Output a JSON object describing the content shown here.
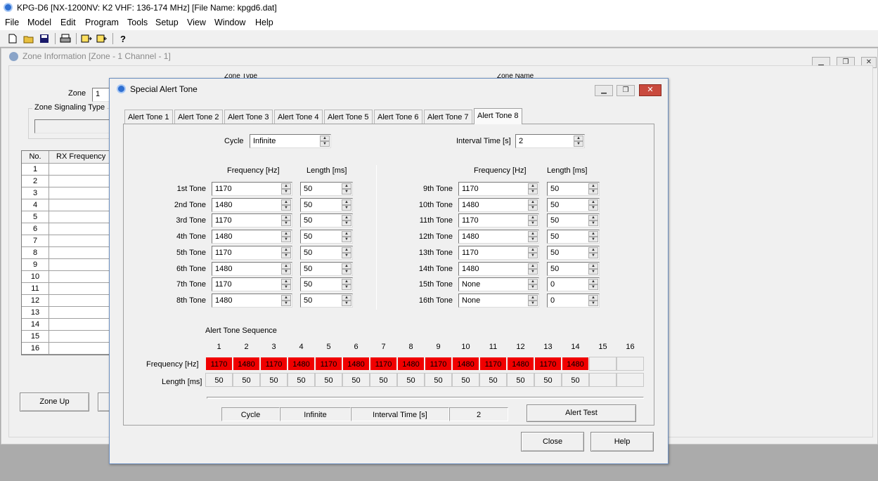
{
  "app": {
    "title": "KPG-D6 [NX-1200NV: K2 VHF: 136-174 MHz] [File Name: kpgd6.dat]"
  },
  "menu": [
    "File",
    "Model",
    "Edit",
    "Program",
    "Tools",
    "Setup",
    "View",
    "Window",
    "Help"
  ],
  "toolbar": {
    "icons": [
      "new-file-icon",
      "open-folder-icon",
      "save-icon",
      "print-icon",
      "read-radio-icon",
      "write-radio-icon",
      "help-icon"
    ]
  },
  "zone_window": {
    "title": "Zone Information [Zone - 1   Channel  -  1]",
    "zone_type_label": "Zone Type",
    "zone_name_label": "Zone Name",
    "zone_label": "Zone",
    "zone_value": "1",
    "signaling_label": "Zone Signaling Type",
    "grid_headers": [
      "No.",
      "RX Frequency"
    ],
    "rows": [
      "1",
      "2",
      "3",
      "4",
      "5",
      "6",
      "7",
      "8",
      "9",
      "10",
      "11",
      "12",
      "13",
      "14",
      "15",
      "16"
    ],
    "zone_up_label": "Zone Up"
  },
  "dialog": {
    "title": "Special Alert Tone",
    "tabs": [
      "Alert Tone 1",
      "Alert Tone 2",
      "Alert Tone 3",
      "Alert Tone 4",
      "Alert Tone 5",
      "Alert Tone 6",
      "Alert Tone 7",
      "Alert Tone 8"
    ],
    "active_tab": "Alert Tone 8",
    "cycle_label": "Cycle",
    "cycle_value": "Infinite",
    "interval_label": "Interval Time [s]",
    "interval_value": "2",
    "freq_header": "Frequency [Hz]",
    "length_header": "Length [ms]",
    "tones_left": [
      {
        "label": "1st Tone",
        "freq": "1170",
        "length": "50"
      },
      {
        "label": "2nd Tone",
        "freq": "1480",
        "length": "50"
      },
      {
        "label": "3rd Tone",
        "freq": "1170",
        "length": "50"
      },
      {
        "label": "4th Tone",
        "freq": "1480",
        "length": "50"
      },
      {
        "label": "5th Tone",
        "freq": "1170",
        "length": "50"
      },
      {
        "label": "6th Tone",
        "freq": "1480",
        "length": "50"
      },
      {
        "label": "7th Tone",
        "freq": "1170",
        "length": "50"
      },
      {
        "label": "8th Tone",
        "freq": "1480",
        "length": "50"
      }
    ],
    "tones_right": [
      {
        "label": "9th Tone",
        "freq": "1170",
        "length": "50"
      },
      {
        "label": "10th Tone",
        "freq": "1480",
        "length": "50"
      },
      {
        "label": "11th Tone",
        "freq": "1170",
        "length": "50"
      },
      {
        "label": "12th Tone",
        "freq": "1480",
        "length": "50"
      },
      {
        "label": "13th Tone",
        "freq": "1170",
        "length": "50"
      },
      {
        "label": "14th Tone",
        "freq": "1480",
        "length": "50"
      },
      {
        "label": "15th Tone",
        "freq": "None",
        "length": "0"
      },
      {
        "label": "16th Tone",
        "freq": "None",
        "length": "0"
      }
    ],
    "sequence_label": "Alert Tone Sequence",
    "seq_numbers": [
      "1",
      "2",
      "3",
      "4",
      "5",
      "6",
      "7",
      "8",
      "9",
      "10",
      "11",
      "12",
      "13",
      "14",
      "15",
      "16"
    ],
    "seq_freq_label": "Frequency [Hz]",
    "seq_length_label": "Length [ms]",
    "seq_freq": [
      "1170",
      "1480",
      "1170",
      "1480",
      "1170",
      "1480",
      "1170",
      "1480",
      "1170",
      "1480",
      "1170",
      "1480",
      "1170",
      "1480",
      "",
      ""
    ],
    "seq_length": [
      "50",
      "50",
      "50",
      "50",
      "50",
      "50",
      "50",
      "50",
      "50",
      "50",
      "50",
      "50",
      "50",
      "50",
      "",
      ""
    ],
    "status": {
      "cycle_label": "Cycle",
      "cycle_value": "Infinite",
      "interval_label": "Interval Time [s]",
      "interval_value": "2"
    },
    "alert_test_label": "Alert Test",
    "close_label": "Close",
    "help_label": "Help",
    "active_color": "#f00000"
  }
}
